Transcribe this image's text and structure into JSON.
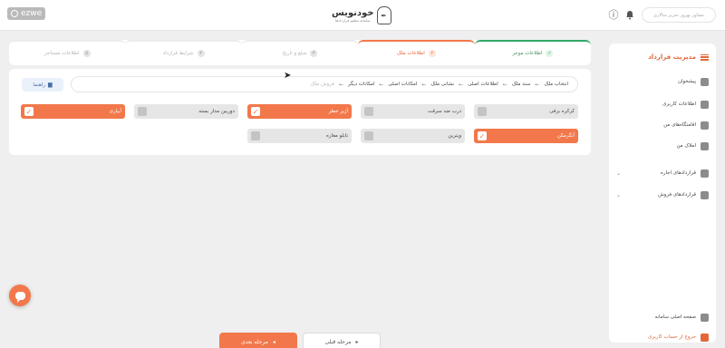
{
  "recorder": {
    "label": "ezwe"
  },
  "header": {
    "logo_text": "خودنویس",
    "logo_subtitle": "سامانه تنظیم قراردادها",
    "user_placeholder": "مشاور بهروز تحریر سالاری"
  },
  "stepper": [
    {
      "num": "✓",
      "label": "اطلاعات موجر",
      "state": "done"
    },
    {
      "num": "۲",
      "label": "اطلاعات ملک",
      "state": "active"
    },
    {
      "num": "۳",
      "label": "مبلغ و تاریخ",
      "state": "todo"
    },
    {
      "num": "۴",
      "label": "شرایط قرارداد",
      "state": "todo"
    },
    {
      "num": "۵",
      "label": "اطلاعات مستاجر",
      "state": "todo"
    }
  ],
  "help_button": {
    "label": "راهنما"
  },
  "tabs": [
    {
      "label": "انتخاب ملک",
      "faded": false
    },
    {
      "label": "سند ملک",
      "faded": false
    },
    {
      "label": "اطلاعات اصلی",
      "faded": false
    },
    {
      "label": "نشانی ملک",
      "faded": false
    },
    {
      "label": "امکانات اصلی",
      "faded": false
    },
    {
      "label": "امکانات دیگر",
      "faded": false
    },
    {
      "label": "فروش ملک",
      "faded": true
    }
  ],
  "options": [
    {
      "label": "کرکره برقی",
      "checked": false
    },
    {
      "label": "درب ضد سرقت",
      "checked": false
    },
    {
      "label": "آژیر خطر",
      "checked": true
    },
    {
      "label": "دوربین مدار بسته",
      "checked": false
    },
    {
      "label": "آبیاری",
      "checked": true
    },
    {
      "label": "آنگرمکن",
      "checked": true
    },
    {
      "label": "ویترین",
      "checked": false
    },
    {
      "label": "تابلو مغازه",
      "checked": false
    }
  ],
  "sidebar": {
    "title": "مدیریت قرارداد",
    "items": [
      {
        "label": "پیشخوان",
        "chevron": false
      },
      {
        "label": "اطلاعات کاربری",
        "chevron": false
      },
      {
        "label": "اقامتگاه‌های من",
        "chevron": false
      },
      {
        "label": "املاک من",
        "chevron": false
      },
      {
        "label": "قراردادهای اجاره",
        "chevron": true
      },
      {
        "label": "قراردادهای فروش",
        "chevron": true
      }
    ],
    "bottom_items": [
      {
        "label": "صفحه اصلی سامانه"
      },
      {
        "label": "خروج از حساب کاربری"
      }
    ]
  },
  "footer": {
    "next_label": "مرحله بعدی",
    "prev_label": "مرحله قبلی"
  }
}
